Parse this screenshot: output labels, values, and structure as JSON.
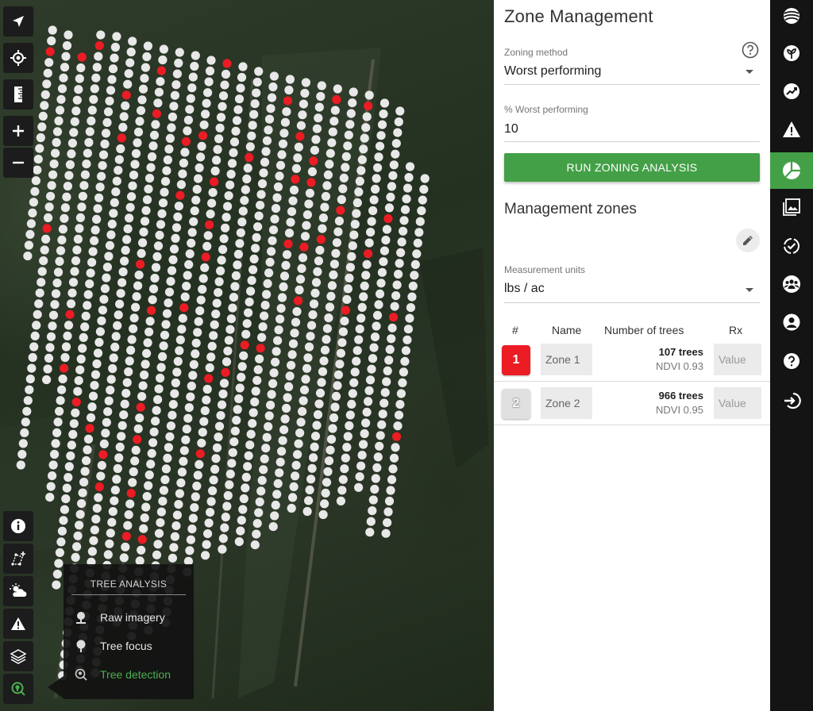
{
  "map": {
    "tree_rows": [
      {
        "count": 22,
        "red": [
          2
        ]
      },
      {
        "count": 41,
        "red": [
          18
        ]
      },
      {
        "count": 31,
        "red": [
          0
        ]
      },
      {
        "count": 44,
        "red": [
          1,
          26,
          31
        ]
      },
      {
        "count": 52,
        "red": [
          34
        ]
      },
      {
        "count": 60,
        "red": [
          5,
          9,
          36
        ]
      },
      {
        "count": 59,
        "red": [
          38,
          41
        ]
      },
      {
        "count": 59,
        "red": [
          2,
          6,
          20
        ]
      },
      {
        "count": 54,
        "red": [
          24,
          33,
          36,
          41,
          45
        ]
      },
      {
        "count": 55,
        "red": [
          8,
          13,
          45
        ]
      },
      {
        "count": 54,
        "red": [
          7,
          23
        ]
      },
      {
        "count": 53,
        "red": [
          0,
          11,
          15,
          18
        ]
      },
      {
        "count": 48,
        "red": [
          29,
          36
        ]
      },
      {
        "count": 46,
        "red": [
          8,
          28
        ]
      },
      {
        "count": 45,
        "red": [
          25
        ]
      },
      {
        "count": 44,
        "red": [
          2,
          25
        ]
      },
      {
        "count": 44,
        "red": [
          5,
          9,
          15
        ]
      },
      {
        "count": 42,
        "red": [
          7,
          9,
          15,
          20
        ]
      },
      {
        "count": 40,
        "red": [
          1,
          14
        ]
      },
      {
        "count": 40,
        "red": [
          11
        ]
      },
      {
        "count": 40,
        "red": [
          1,
          20
        ]
      },
      {
        "count": 38,
        "red": [
          14
        ]
      },
      {
        "count": 36,
        "red": [
          10
        ]
      },
      {
        "count": 35,
        "red": [
          14
        ]
      },
      {
        "count": 34,
        "red": [
          24
        ]
      }
    ],
    "tree_analysis": {
      "title": "TREE ANALYSIS",
      "items": [
        {
          "label": "Raw imagery",
          "icon": "raw-imagery-icon",
          "active": false
        },
        {
          "label": "Tree focus",
          "icon": "tree-focus-icon",
          "active": false
        },
        {
          "label": "Tree detection",
          "icon": "tree-detection-icon",
          "active": true
        }
      ]
    },
    "controls": {
      "top": [
        "navigate-arrow-icon",
        "crosshair-icon",
        "ruler-icon",
        "zoom-in-icon",
        "zoom-out-icon"
      ],
      "bottom": [
        "info-icon",
        "draw-polygon-icon",
        "weather-icon",
        "warning-icon",
        "layers-icon",
        "tree-detection-icon"
      ]
    }
  },
  "panel": {
    "title": "Zone Management",
    "zoning_method": {
      "label": "Zoning method",
      "value": "Worst performing"
    },
    "worst_pct": {
      "label": "% Worst performing",
      "value": "10"
    },
    "run_button": "RUN ZONING ANALYSIS",
    "zones_title": "Management zones",
    "units": {
      "label": "Measurement units",
      "value": "lbs / ac"
    },
    "table": {
      "headers": {
        "num": "#",
        "name": "Name",
        "trees": "Number of trees",
        "rx": "Rx"
      },
      "rows": [
        {
          "num": "1",
          "name": "Zone 1",
          "trees": "107 trees",
          "ndvi": "NDVI 0.93",
          "rx_placeholder": "Value",
          "color": "#ec1c24"
        },
        {
          "num": "2",
          "name": "Zone 2",
          "trees": "966 trees",
          "ndvi": "NDVI 0.95",
          "rx_placeholder": "Value",
          "color": "#e0e0e0"
        }
      ]
    }
  },
  "nav": {
    "items": [
      "globe-icon",
      "plant-icon",
      "trend-icon",
      "warning-icon",
      "zones-pie-icon",
      "images-icon",
      "check-badge-icon",
      "team-icon",
      "account-icon",
      "help-icon",
      "logout-icon"
    ],
    "active": "zones-pie-icon"
  },
  "colors": {
    "accent": "#43a047",
    "zone_red": "#ec1c24",
    "tree_white": "#e8e8e8"
  }
}
